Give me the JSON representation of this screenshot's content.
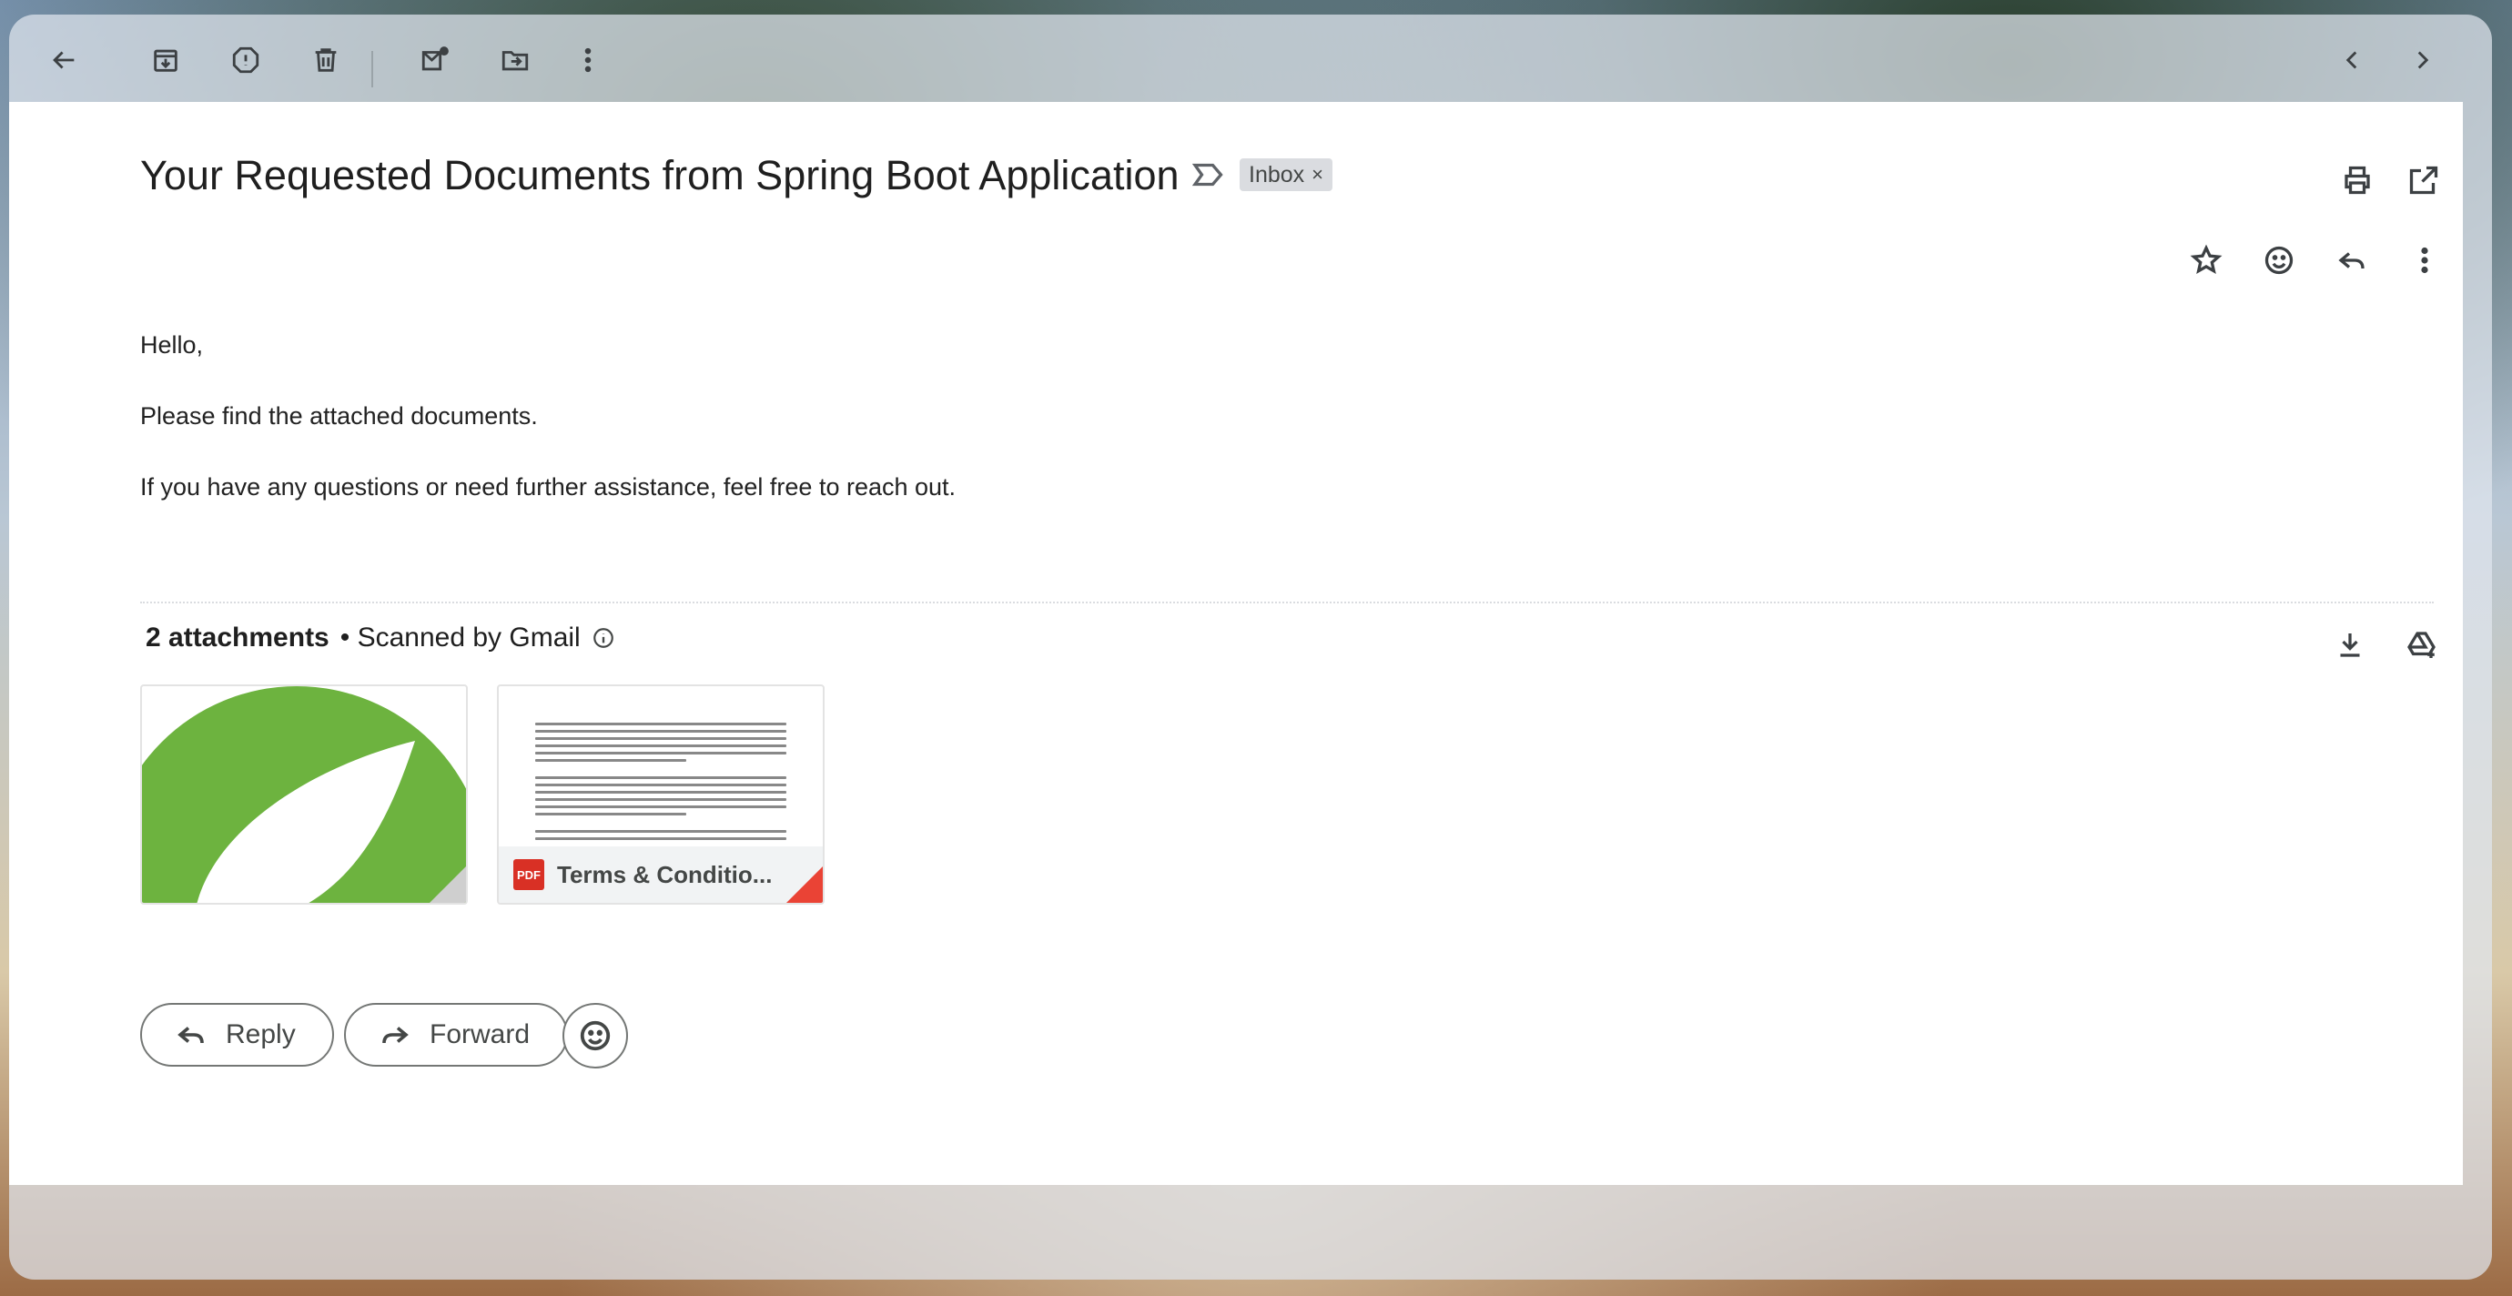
{
  "email": {
    "subject": "Your Requested Documents from Spring Boot Application",
    "label_chip": "Inbox",
    "label_chip_close": "×",
    "body": {
      "greeting": "Hello,",
      "line1": "Please find the attached documents.",
      "line2": "If you have any questions or need further assistance, feel free to reach out."
    }
  },
  "attachments": {
    "count_label": "2 attachments",
    "scanned_label": "• Scanned by Gmail",
    "items": [
      {
        "type": "image",
        "icon": "spring-leaf-logo"
      },
      {
        "type": "pdf",
        "badge": "PDF",
        "name": "Terms & Conditio..."
      }
    ]
  },
  "actions": {
    "reply_label": "Reply",
    "forward_label": "Forward"
  },
  "colors": {
    "spring_green": "#6db33f",
    "pdf_red": "#d93025"
  }
}
